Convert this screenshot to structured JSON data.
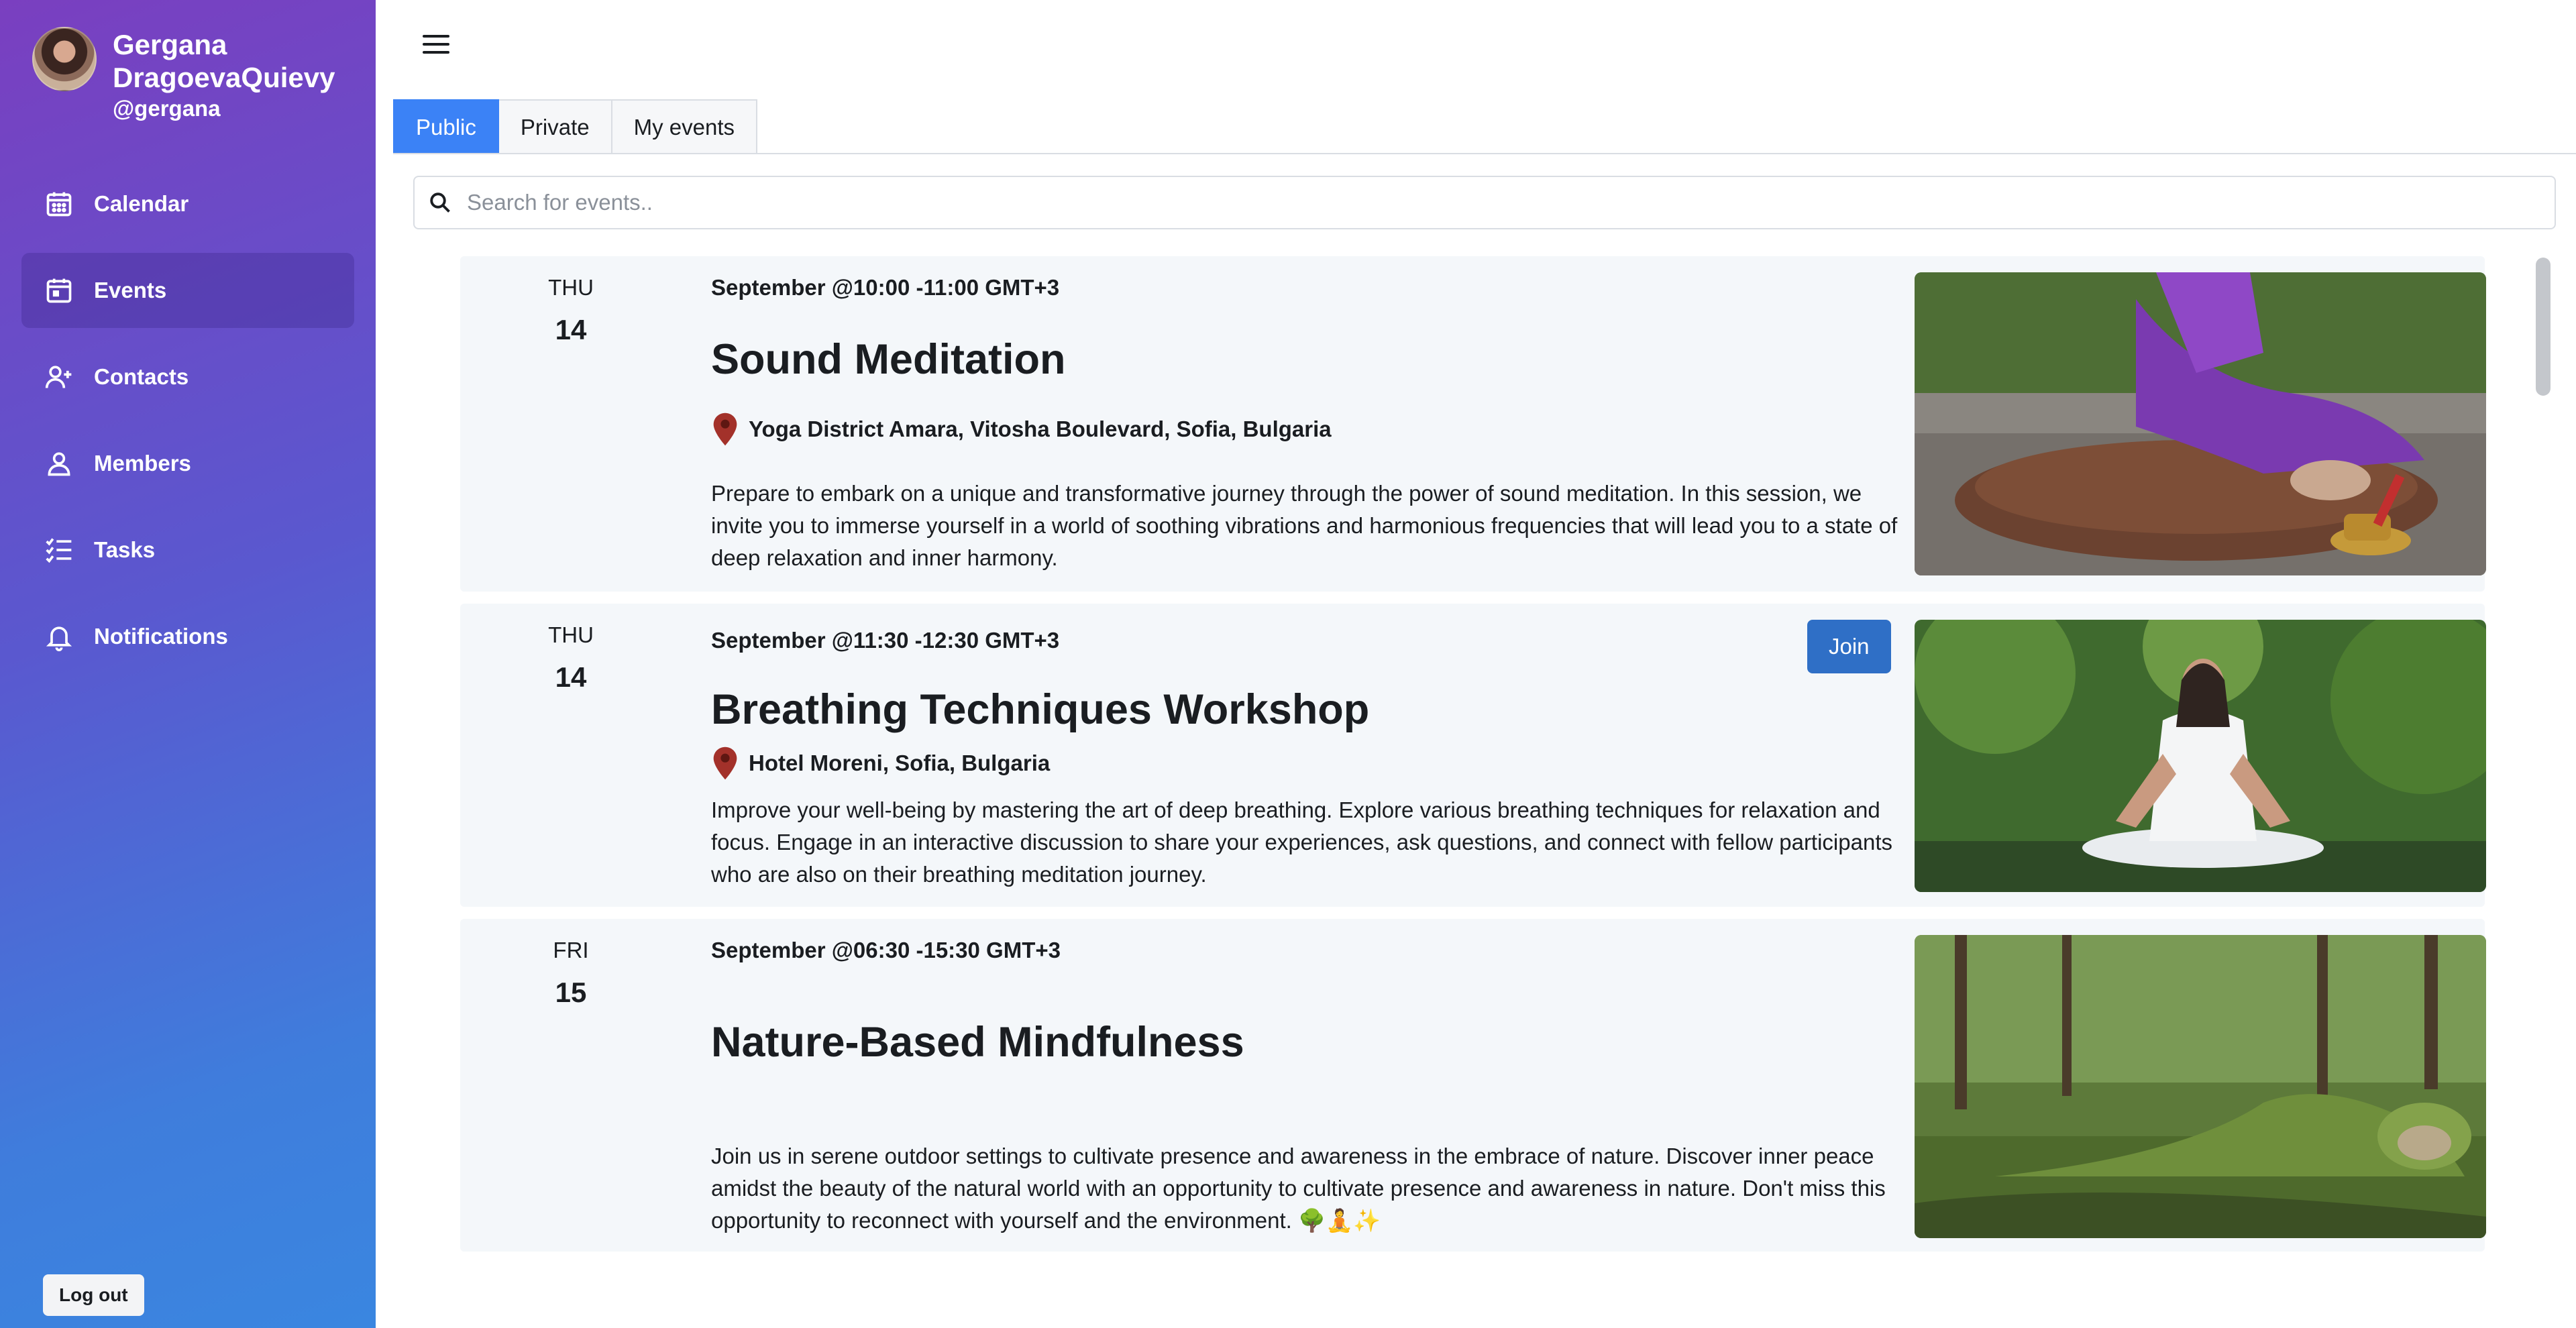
{
  "user": {
    "name": "Gergana DragoevaQuievy",
    "handle": "@gergana"
  },
  "nav": [
    {
      "label": "Calendar",
      "icon": "calendar-icon"
    },
    {
      "label": "Events",
      "icon": "event-calendar-icon"
    },
    {
      "label": "Contacts",
      "icon": "user-plus-icon"
    },
    {
      "label": "Members",
      "icon": "user-icon"
    },
    {
      "label": "Tasks",
      "icon": "checklist-icon"
    },
    {
      "label": "Notifications",
      "icon": "bell-icon"
    }
  ],
  "logout_label": "Log out",
  "tabs": [
    "Public",
    "Private",
    "My events"
  ],
  "search": {
    "placeholder": "Search for events.."
  },
  "events": [
    {
      "day": "THU",
      "date": "14",
      "time": "September @10:00 -11:00 GMT+3",
      "title": "Sound Meditation",
      "location": "Yoga District Amara, Vitosha Boulevard, Sofia, Bulgaria",
      "description": "Prepare to embark on a unique and transformative journey through the power of sound meditation. In this session, we invite you to immerse yourself in a world of soothing vibrations and harmonious frequencies that will lead you to a state of deep relaxation and inner harmony."
    },
    {
      "day": "THU",
      "date": "14",
      "time": "September @11:30 -12:30 GMT+3",
      "title": "Breathing Techniques Workshop",
      "location": "Hotel Moreni, Sofia, Bulgaria",
      "description": "Improve your well-being by mastering the art of deep breathing. Explore various breathing techniques for relaxation and focus. Engage in an interactive discussion to share your experiences, ask questions, and connect with fellow participants who are also on their breathing meditation journey.",
      "join_label": "Join"
    },
    {
      "day": "FRI",
      "date": "15",
      "time": "September @06:30 -15:30 GMT+3",
      "title": "Nature-Based Mindfulness",
      "description": "Join us in serene outdoor settings to cultivate presence and awareness in the embrace of nature. Discover inner peace amidst the beauty of the natural world with an opportunity to cultivate presence and awareness in nature. Don't miss this opportunity to reconnect with yourself and the environment. 🌳🧘✨"
    }
  ],
  "colors": {
    "accent": "#3b82f6",
    "join_button": "#2f6fc6",
    "pin": "#a3312a",
    "event_bg": "#f4f7fa"
  }
}
